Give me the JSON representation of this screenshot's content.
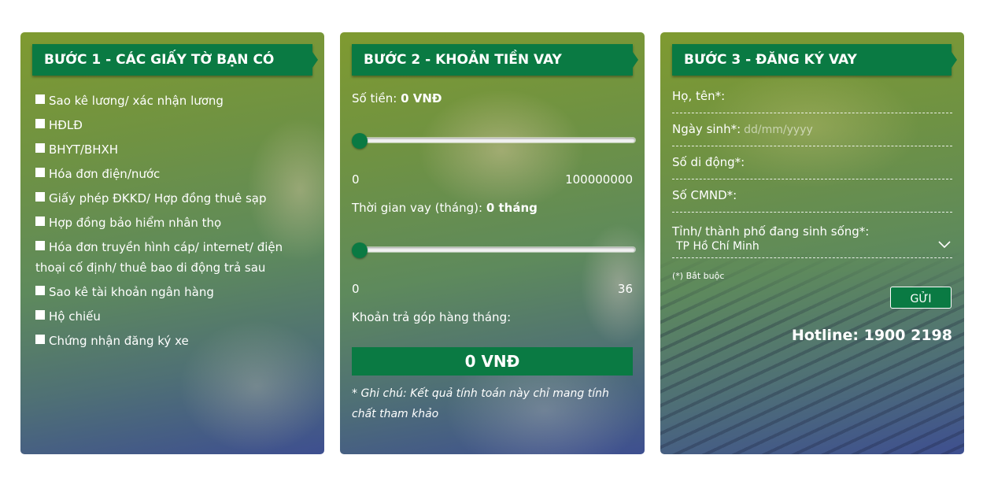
{
  "step1": {
    "title": "BƯỚC 1 - CÁC GIẤY TỜ BẠN CÓ",
    "items": [
      "Sao kê lương/ xác nhận lương",
      "HĐLĐ",
      "BHYT/BHXH",
      "Hóa đơn điện/nước",
      "Giấy phép ĐKKD/ Hợp đồng thuê sạp",
      "Hợp đồng bảo hiểm nhân thọ",
      "Hóa đơn truyền hình cáp/ internet/ điện thoại cố định/ thuê bao di động trả sau",
      "Sao kê tài khoản ngân hàng",
      "Hộ chiếu",
      "Chứng nhận đăng ký xe"
    ]
  },
  "step2": {
    "title": "BƯỚC 2 - KHOẢN TIỀN VAY",
    "amount_label": "Số tiền:",
    "amount_value": "0 VNĐ",
    "amount_min": "0",
    "amount_max": "100000000",
    "amount_level": 0,
    "term_label": "Thời gian vay (tháng):",
    "term_value": "0 tháng",
    "term_min": "0",
    "term_max": "36",
    "term_level": 0,
    "monthly_label": "Khoản trả góp hàng tháng:",
    "monthly_value": "0 VNĐ",
    "note": "* Ghi chú: Kết quả tính toán này chỉ mang tính chất tham khảo"
  },
  "step3": {
    "title": "BƯỚC 3 - ĐĂNG KÝ VAY",
    "name_label": "Họ, tên*:",
    "dob_label": "Ngày sinh*:",
    "dob_placeholder": "dd/mm/yyyy",
    "phone_label": "Số di động*:",
    "id_label": "Số CMND*:",
    "city_label": "Tỉnh/ thành phố đang sinh sống*:",
    "city_value": "TP Hồ Chí Minh",
    "required_note": "(*) Bắt buộc",
    "send_label": "GỬI",
    "hotline": "Hotline: 1900 2198"
  },
  "colors": {
    "brand_green": "#0a7a43",
    "text": "#ffffff"
  }
}
